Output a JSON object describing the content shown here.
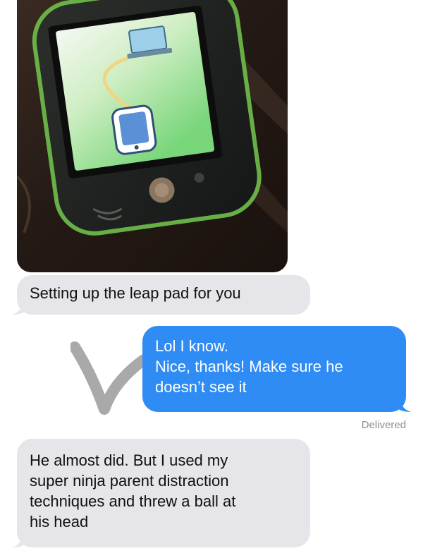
{
  "messages": [
    {
      "id": "m1",
      "direction": "received",
      "attachment": "leappad-photo",
      "lines": [
        "Setting up the leap pad for you"
      ]
    },
    {
      "id": "m2",
      "direction": "sent",
      "lines": [
        "Lol I know.",
        "Nice, thanks! Make sure he",
        "doesn’t see it"
      ]
    },
    {
      "id": "m3",
      "direction": "received",
      "lines": [
        "He almost did. But I used my",
        "super ninja parent distraction",
        "techniques and threw a ball at",
        "his head"
      ]
    }
  ],
  "status": {
    "delivered": "Delivered"
  },
  "colors": {
    "sent_bubble": "#2f8cf5",
    "received_bubble": "#e5e5ea",
    "status_text": "#8e8e93"
  },
  "icons": {
    "overlay": "checkmark-icon",
    "photo_subject": "leappad-tablet"
  }
}
